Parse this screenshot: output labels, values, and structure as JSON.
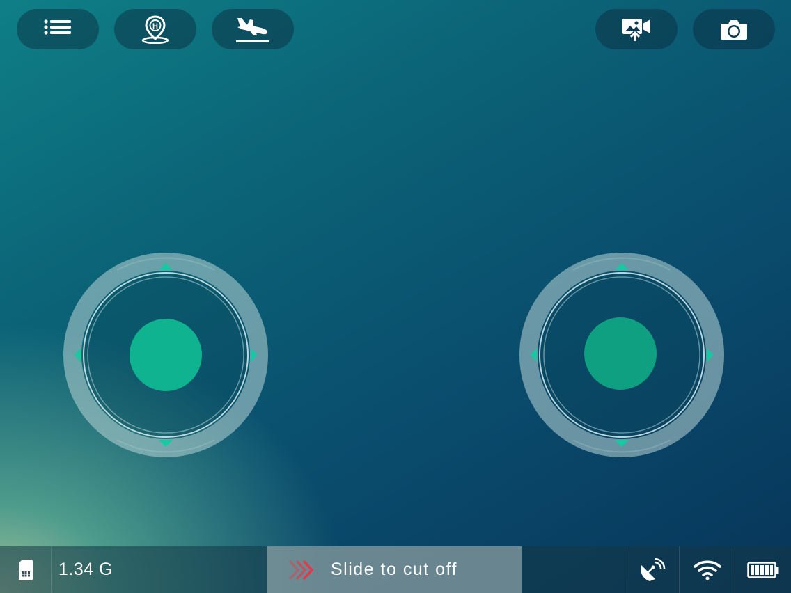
{
  "top_bar": {
    "left_buttons": [
      {
        "name": "menu-button",
        "icon": "list-icon"
      },
      {
        "name": "home-point-button",
        "icon": "home-location-icon"
      },
      {
        "name": "land-button",
        "icon": "landing-plane-icon"
      }
    ],
    "right_buttons": [
      {
        "name": "media-gallery-button",
        "icon": "video-gallery-icon"
      },
      {
        "name": "camera-button",
        "icon": "camera-icon"
      }
    ]
  },
  "joysticks": {
    "left": {
      "name": "left-joystick",
      "knob_color": "#0fb38f"
    },
    "right": {
      "name": "right-joystick",
      "knob_color": "#0fa082"
    }
  },
  "bottom_bar": {
    "storage_icon": "sd-card-icon",
    "storage_value": "1.34 G",
    "slide_label": "Slide to cut off",
    "slide_arrow_icon": "double-chevron-right-icon",
    "slide_arrow_color": "#e23a4a",
    "status_icons": [
      "satellite-icon",
      "wifi-icon",
      "battery-icon"
    ]
  },
  "colors": {
    "accent": "#17c8a0",
    "ring": "#b9d6d6"
  }
}
